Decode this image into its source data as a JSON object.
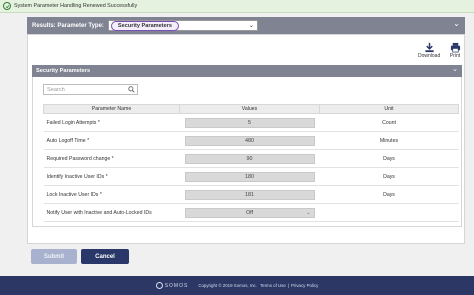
{
  "notification": {
    "text": "System Parameter Handling Renewed Successfully"
  },
  "results_bar": {
    "label": "Results: Parameter Type:",
    "selected": "Security Parameters"
  },
  "actions": {
    "download": "Download",
    "print": "Print"
  },
  "section": {
    "title": "Security Parameters"
  },
  "search": {
    "placeholder": "Search"
  },
  "table": {
    "headers": [
      "Parameter Name",
      "Values",
      "Unit"
    ],
    "rows": [
      {
        "name": "Failed Login Attempts *",
        "value": "5",
        "unit": "Count"
      },
      {
        "name": "Auto Logoff Time *",
        "value": "480",
        "unit": "Minutes"
      },
      {
        "name": "Required Password change *",
        "value": "90",
        "unit": "Days"
      },
      {
        "name": "Identify Inactive User IDs *",
        "value": "180",
        "unit": "Days"
      },
      {
        "name": "Lock Inactive User IDs *",
        "value": "181",
        "unit": "Days"
      },
      {
        "name": "Notify User with Inactive and Auto-Locked IDs",
        "value": "Off",
        "unit": ""
      }
    ]
  },
  "buttons": {
    "submit": "Submit",
    "cancel": "Cancel"
  },
  "footer": {
    "logo": "SOMOS",
    "copyright": "Copyright © 2019 Somos, Inc.",
    "terms": "Terms of Use",
    "separator": "|",
    "privacy": "Privacy Policy"
  },
  "colors": {
    "header_bar": "#7f8392",
    "primary_button": "#2a3869",
    "footer_bg": "#2c3766",
    "success_bg": "#e6f2e0"
  }
}
